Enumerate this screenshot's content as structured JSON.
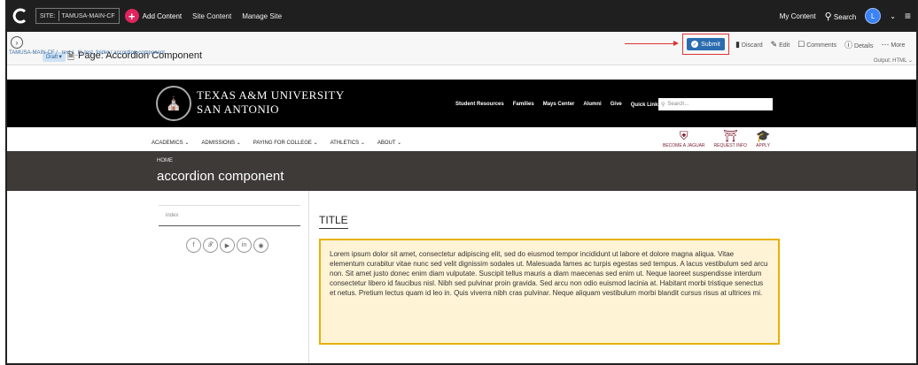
{
  "topbar": {
    "site_label": "SITE:",
    "site_name": "TAMUSA-MAIN-CF",
    "add_content": "Add Content",
    "site_content": "Site Content",
    "manage_site": "Manage Site",
    "my_content": "My Content",
    "search": "Search",
    "avatar_letter": "L"
  },
  "pagebar": {
    "draft": "Draft",
    "page_title": "Page: Accordion Component",
    "submit": "Submit",
    "discard": "Discard",
    "edit": "Edit",
    "comments": "Comments",
    "details": "Details",
    "more": "More",
    "output": "Output: HTML"
  },
  "breadcrumb": "TAMUSA-MAIN-CF / _test / _lli_test_folder / accordion-component",
  "site": {
    "uni_line1": "TEXAS A&M UNIVERSITY",
    "uni_line2": "SAN ANTONIO",
    "nav": [
      "Student Resources",
      "Families",
      "Mays Center",
      "Alumni",
      "Give",
      "Quick Links"
    ],
    "search_placeholder": "Search..."
  },
  "mainnav": {
    "items": [
      "ACADEMICS",
      "ADMISSIONS",
      "PAYING FOR COLLEGE",
      "ATHLETICS",
      "ABOUT"
    ],
    "cta": [
      "BECOME A JAGUAR",
      "REQUEST INFO",
      "APPLY"
    ]
  },
  "hero": {
    "home": "HOME",
    "title": "accordion component"
  },
  "sidebar": {
    "index": "index"
  },
  "content": {
    "title": "TITLE",
    "body": "Lorem ipsum dolor sit amet, consectetur adipiscing elit, sed do eiusmod tempor incididunt ut labore et dolore magna aliqua. Vitae elementum curabitur vitae nunc sed velit dignissim sodales ut. Malesuada fames ac turpis egestas sed tempus. A lacus vestibulum sed arcu non. Sit amet justo donec enim diam vulputate. Suscipit tellus mauris a diam maecenas sed enim ut. Neque laoreet suspendisse interdum consectetur libero id faucibus nisl. Nibh sed pulvinar proin gravida. Sed arcu non odio euismod lacinia at. Habitant morbi tristique senectus et netus. Pretium lectus quam id leo in. Quis viverra nibh cras pulvinar. Neque aliquam vestibulum morbi blandit cursus risus at ultrices mi."
  }
}
